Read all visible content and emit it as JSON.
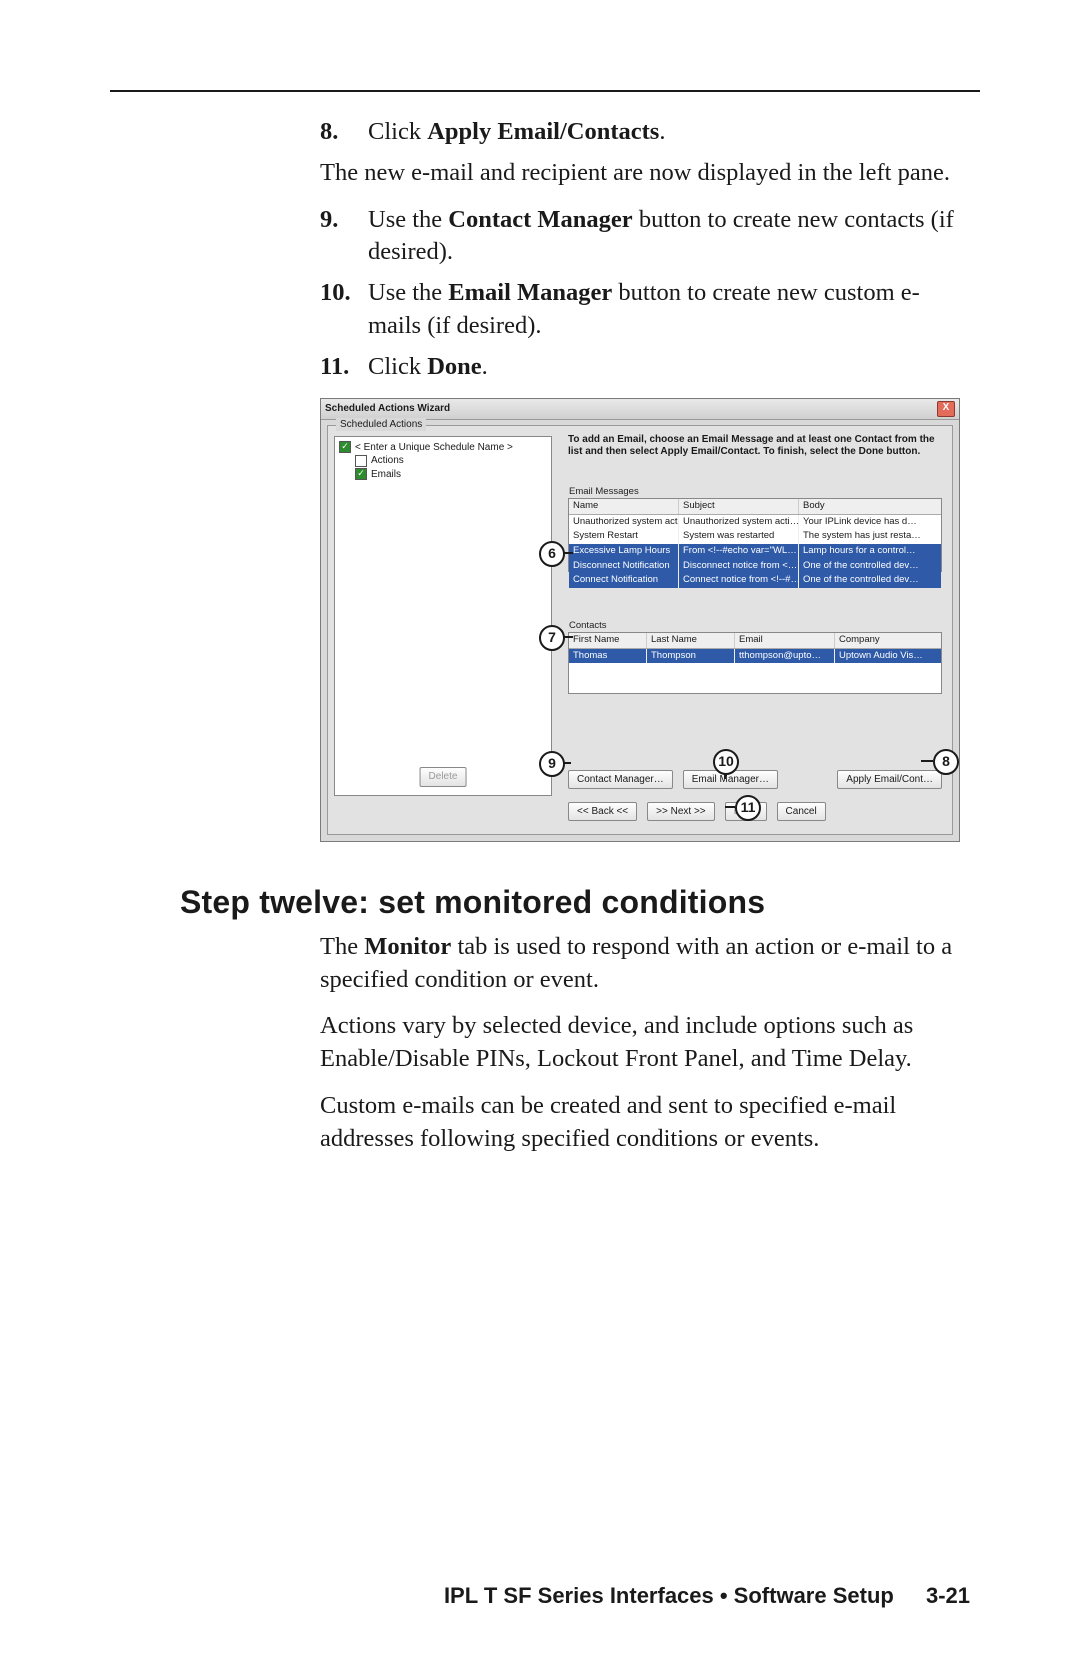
{
  "steps": {
    "s8": {
      "num": "8.",
      "prefix": "Click ",
      "bold": "Apply Email/Contacts",
      "suffix": "."
    },
    "after8": "The new e-mail and recipient are now displayed in the left pane.",
    "s9": {
      "num": "9.",
      "prefix": "Use the ",
      "bold": "Contact Manager",
      "suffix": " button to create new contacts (if desired)."
    },
    "s10": {
      "num": "10.",
      "prefix": "Use the ",
      "bold": "Email Manager",
      "suffix": " button to create new custom e-mails (if desired)."
    },
    "s11": {
      "num": "11.",
      "prefix": "Click ",
      "bold": "Done",
      "suffix": "."
    }
  },
  "screenshot": {
    "title": "Scheduled Actions Wizard",
    "close_glyph": "X",
    "group_label": "Scheduled Actions",
    "tree": {
      "root": "< Enter a Unique Schedule Name >",
      "item_actions": "Actions",
      "item_emails": "Emails"
    },
    "instruction": "To add an Email, choose an Email Message and at least one Contact from the list and then select Apply Email/Contact. To finish, select the Done button.",
    "email_table": {
      "title": "Email Messages",
      "headers": {
        "c1": "Name",
        "c2": "Subject",
        "c3": "Body"
      },
      "rows": [
        {
          "c1": "Unauthorized system activity",
          "c2": "Unauthorized system acti…",
          "c3": "Your IPLink device has d…"
        },
        {
          "c1": "System Restart",
          "c2": "System was restarted",
          "c3": "The system has just resta…"
        },
        {
          "c1": "Excessive Lamp Hours",
          "c2": "From <!--#echo var=\"WL…",
          "c3": "Lamp hours for a control…"
        },
        {
          "c1": "Disconnect Notification",
          "c2": "Disconnect notice from <…",
          "c3": "One of the controlled dev…"
        },
        {
          "c1": "Connect Notification",
          "c2": "Connect notice from <!--#…",
          "c3": "One of the controlled dev…"
        }
      ]
    },
    "contacts_table": {
      "title": "Contacts",
      "headers": {
        "c1": "First Name",
        "c2": "Last Name",
        "c3": "Email",
        "c4": "Company"
      },
      "rows": [
        {
          "c1": "Thomas",
          "c2": "Thompson",
          "c3": "tthompson@upto…",
          "c4": "Uptown Audio Vis…"
        }
      ]
    },
    "buttons": {
      "delete": "Delete",
      "contact_manager": "Contact Manager…",
      "email_manager": "Email Manager…",
      "apply_email": "Apply Email/Cont…",
      "back": "<< Back <<",
      "next": ">> Next >>",
      "done": "Done",
      "cancel": "Cancel"
    },
    "callouts": {
      "c6": "6",
      "c7": "7",
      "c8": "8",
      "c9": "9",
      "c10": "10",
      "c11": "11"
    }
  },
  "section_title": "Step twelve: set monitored conditions",
  "monitor": {
    "p1_pre": "The ",
    "p1_bold": "Monitor",
    "p1_post": " tab is used to respond with an action or e-mail to a specified condition or event.",
    "p2": "Actions vary by selected device, and include options such as Enable/Disable PINs, Lockout Front Panel, and Time Delay.",
    "p3": "Custom e-mails can be created and sent to specified e-mail addresses following specified conditions or events."
  },
  "footer": {
    "chapter": "IPL T SF Series Interfaces • Software Setup",
    "page": "3-21"
  }
}
